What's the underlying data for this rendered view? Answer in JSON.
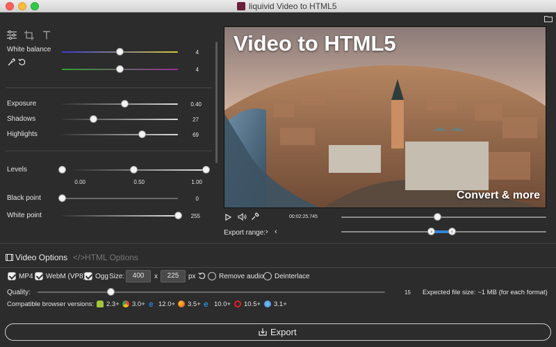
{
  "window": {
    "title": "liquivid Video to HTML5"
  },
  "toolbar": {
    "icons": [
      "sliders-icon",
      "crop-icon",
      "text-icon"
    ],
    "folder_icon": "folder-icon"
  },
  "adjustments": {
    "white_balance": {
      "label": "White balance",
      "slider1_value": "4",
      "slider2_value": "4",
      "slider1_level": 0.5,
      "slider2_level": 0.5
    },
    "exposure": {
      "label": "Exposure",
      "value": "0.40",
      "level": 0.54
    },
    "shadows": {
      "label": "Shadows",
      "value": "27",
      "level": 0.27
    },
    "highlights": {
      "label": "Highlights",
      "value": "69",
      "level": 0.69
    },
    "levels": {
      "label": "Levels",
      "ticks": [
        "0.00",
        "0.50",
        "1.00"
      ],
      "levels": [
        0.0,
        0.5,
        1.0
      ]
    },
    "black_point": {
      "label": "Black point",
      "value": "0",
      "level": 0.0
    },
    "white_point": {
      "label": "White point",
      "value": "255",
      "level": 1.0
    }
  },
  "preview": {
    "overlay_title": "Video to HTML5",
    "overlay_caption": "Convert & more",
    "timecode": "00:02:25.745",
    "position_level": 0.47,
    "export_range_label": "Export range:",
    "range_start": 0.44,
    "range_end": 0.54
  },
  "tabs": {
    "video_options": "Video Options",
    "html_options": "HTML Options",
    "html_icon": "code-icon",
    "video_icon": "film-icon"
  },
  "formats": {
    "mp4": "MP4",
    "webm": "WebM (VP8)",
    "ogg": "Ogg"
  },
  "size": {
    "label": "Size:",
    "width": "400",
    "x": "x",
    "height": "225",
    "unit": "px"
  },
  "options": {
    "remove_audio": "Remove audio",
    "deinterlace": "Deinterlace"
  },
  "quality": {
    "label": "Quality:",
    "value": "15",
    "level": 0.21,
    "file_size": "Expected file size:  ~1 MB  (for each format)"
  },
  "browsers": {
    "label": "Compatible browser versions:",
    "items": [
      {
        "icon": "android-icon",
        "version": "2.3+",
        "color": "#a4c639"
      },
      {
        "icon": "chrome-icon",
        "version": "3.0+",
        "color": "#e8453c"
      },
      {
        "icon": "edge-icon",
        "version": "12.0+",
        "color": "#2a7fd6"
      },
      {
        "icon": "firefox-icon",
        "version": "3.5+",
        "color": "#f07c1e"
      },
      {
        "icon": "ie-icon",
        "version": "10.0+",
        "color": "#1e90d6"
      },
      {
        "icon": "opera-icon",
        "version": "10.5+",
        "color": "#e0202b"
      },
      {
        "icon": "safari-icon",
        "version": "3.1+",
        "color": "#3b8fe0"
      }
    ]
  },
  "export": {
    "label": "Export",
    "icon": "export-icon"
  },
  "colors": {
    "accent": "#2f86d6",
    "wb_yellow": "#d4c93a",
    "wb_blue": "#3a3ad6",
    "wb_green": "#2fa02f",
    "wb_purple": "#9a2f9a"
  }
}
